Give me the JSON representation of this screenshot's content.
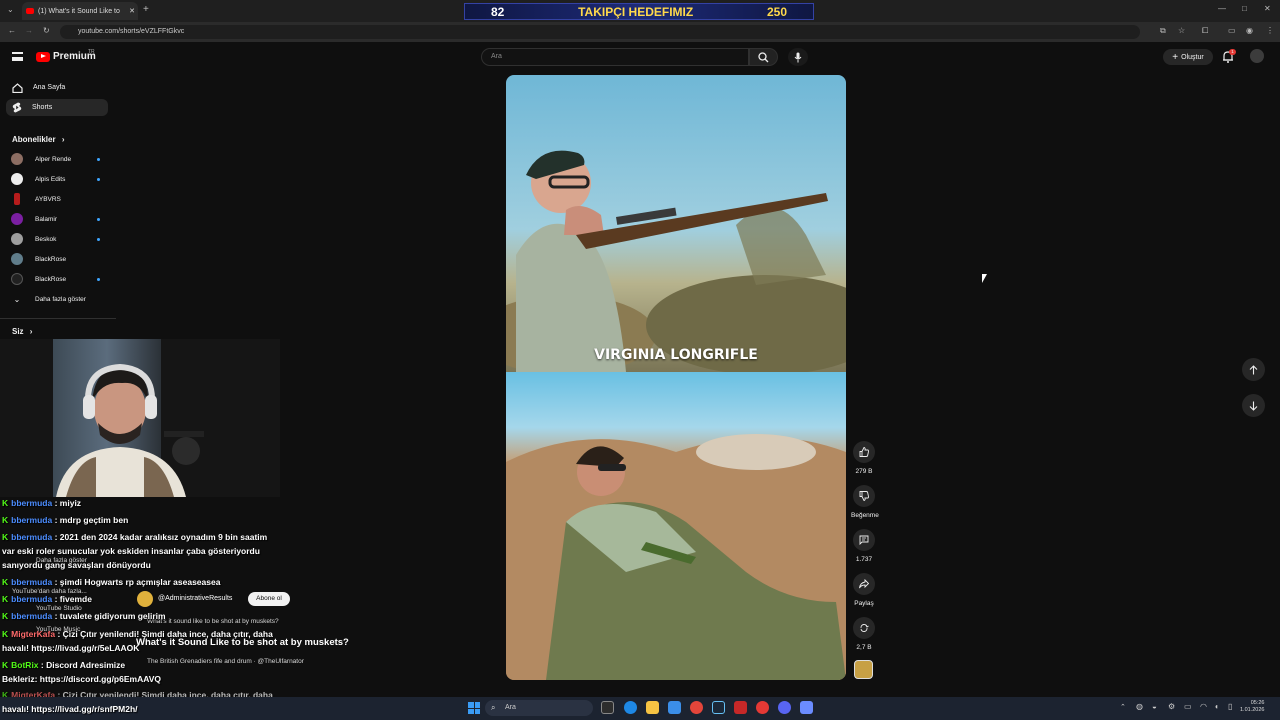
{
  "browser": {
    "tab_title": "(1) What's it Sound Like to",
    "url": "youtube.com/shorts/eVZLFFtGkvc"
  },
  "banner": {
    "left_value": "82",
    "title": "TAKIPÇI HEDEFIMIZ",
    "right_value": "250"
  },
  "header": {
    "logo_text": "Premium",
    "logo_region": "TR",
    "search_placeholder": "Ara",
    "create_label": "Oluştur",
    "notification_count": "1"
  },
  "sidebar": {
    "items": [
      {
        "label": "Ana Sayfa",
        "icon": "home-icon"
      },
      {
        "label": "Shorts",
        "icon": "shorts-icon"
      }
    ],
    "subscriptions_title": "Abonelikler",
    "subscriptions": [
      {
        "name": "Alper Rende",
        "color": "#8d6e63",
        "live": true
      },
      {
        "name": "Alpis Edits",
        "color": "#eeeeee",
        "live": true
      },
      {
        "name": "AYBVRS",
        "color": "#b71c1c",
        "live": false
      },
      {
        "name": "Balamir",
        "color": "#7b1fa2",
        "live": true
      },
      {
        "name": "Beskok",
        "color": "#9e9e9e",
        "live": true
      },
      {
        "name": "BlackRose",
        "color": "#607d8b",
        "live": false
      },
      {
        "name": "BlackRose",
        "color": "#212121",
        "live": true
      }
    ],
    "show_more": "Daha fazla göster",
    "you_title": "Siz"
  },
  "video": {
    "caption": "VIRGINIA LONGRIFLE"
  },
  "actions": {
    "like_count": "279 B",
    "dislike_label": "Beğenme",
    "comment_count": "1.737",
    "share_label": "Paylaş",
    "remix_count": "2,7 B"
  },
  "chat": [
    {
      "user": "bbermuda",
      "text": ": miyiz"
    },
    {
      "user": "bbermuda",
      "text": ": mdrp geçtim ben"
    },
    {
      "user": "bbermuda",
      "text": ": 2021 den 2024 kadar aralıksız oynadım 9 bin saatim"
    },
    {
      "user": "",
      "text": "var eski roler sunucular yok eskiden insanlar çaba gösteriyordu"
    },
    {
      "user": "",
      "text": "sanıyordu gang savaşları dönüyordu"
    },
    {
      "user": "bbermuda",
      "text": ": şimdi Hogwarts rp açmışlar aseaseasea"
    },
    {
      "user": "bbermuda",
      "text": ": fivemde"
    },
    {
      "user": "bbermuda",
      "text": ": tuvalete gidiyorum gelirim"
    },
    {
      "user": "MigterKafa",
      "text": ": Çizi Çıtır yenilendi! Şimdi daha ince, daha çıtır, daha"
    },
    {
      "user": "",
      "text": "havalı! https://livad.gg/r/5eLAAOK"
    },
    {
      "user": "BotRix",
      "text": ": Discord Adresimize"
    },
    {
      "user": "",
      "text": "Bekleriz: https://discord.gg/p6EmAAVQ"
    },
    {
      "user": "MigterKafa",
      "text": ": Çizi Çıtır yenilendi! Şimdi daha ince, daha çıtır, daha"
    },
    {
      "user": "",
      "text": "havalı! https://livad.gg/r/snfPM2h/"
    }
  ],
  "shorts_info": {
    "channel": "@AdministrativeResults",
    "subscribe_label": "Abone ol",
    "description": "What's it sound like to be shot at by muskets?",
    "title": "What's it Sound Like to be shot at by muskets?",
    "music": "The British Grenadiers fife and drum · @TheUlfarnator"
  },
  "ghost_sidebar": {
    "more_from_youtube": "YouTube'dan daha fazla...",
    "studio": "YouTube Studio",
    "music": "YouTube Music",
    "show_more": "Daha fazla göster"
  },
  "taskbar": {
    "search_placeholder": "Ara",
    "time": "05:26",
    "date": "1.01.2026"
  }
}
